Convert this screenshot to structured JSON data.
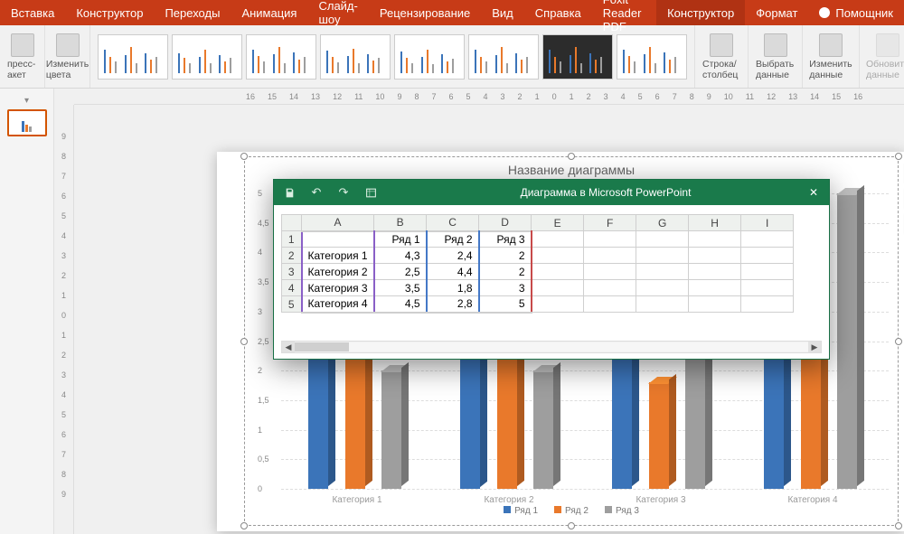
{
  "ribbonTabs": [
    {
      "label": "Вставка"
    },
    {
      "label": "Конструктор"
    },
    {
      "label": "Переходы"
    },
    {
      "label": "Анимация"
    },
    {
      "label": "Слайд-шоу"
    },
    {
      "label": "Рецензирование"
    },
    {
      "label": "Вид"
    },
    {
      "label": "Справка"
    },
    {
      "label": "Foxit Reader PDF"
    },
    {
      "label": "Конструктор",
      "active": true
    },
    {
      "label": "Формат"
    },
    {
      "label": "Помощник",
      "help": true
    }
  ],
  "ribbonGroups": {
    "express": "пресс-\nакет",
    "changeColors": "Изменить\nцвета",
    "rowCol": "Строка/\nстолбец",
    "selectData": "Выбрать\nданные",
    "editData": "Изменить\nданные",
    "refreshData": "Обновить\nданные"
  },
  "dataWindow": {
    "title": "Диаграмма в Microsoft PowerPoint",
    "columns": [
      "A",
      "B",
      "C",
      "D",
      "E",
      "F",
      "G",
      "H",
      "I"
    ],
    "headers": [
      "",
      "Ряд 1",
      "Ряд 2",
      "Ряд 3"
    ],
    "rows": [
      {
        "n": "2",
        "cat": "Категория 1",
        "v": [
          "4,3",
          "2,4",
          "2"
        ]
      },
      {
        "n": "3",
        "cat": "Категория 2",
        "v": [
          "2,5",
          "4,4",
          "2"
        ]
      },
      {
        "n": "4",
        "cat": "Категория 3",
        "v": [
          "3,5",
          "1,8",
          "3"
        ]
      },
      {
        "n": "5",
        "cat": "Категория 4",
        "v": [
          "4,5",
          "2,8",
          "5"
        ]
      }
    ]
  },
  "chart": {
    "title": "Название диаграммы",
    "yticks": [
      "0",
      "0,5",
      "1",
      "1,5",
      "2",
      "2,5",
      "3",
      "3,5",
      "4",
      "4,5",
      "5"
    ],
    "legend": [
      "Ряд 1",
      "Ряд 2",
      "Ряд 3"
    ]
  },
  "rulerH": [
    "16",
    "15",
    "14",
    "13",
    "12",
    "11",
    "10",
    "9",
    "8",
    "7",
    "6",
    "5",
    "4",
    "3",
    "2",
    "1",
    "0",
    "1",
    "2",
    "3",
    "4",
    "5",
    "6",
    "7",
    "8",
    "9",
    "10",
    "11",
    "12",
    "13",
    "14",
    "15",
    "16"
  ],
  "rulerV": [
    "9",
    "8",
    "7",
    "6",
    "5",
    "4",
    "3",
    "2",
    "1",
    "0",
    "1",
    "2",
    "3",
    "4",
    "5",
    "6",
    "7",
    "8",
    "9"
  ],
  "chart_data": {
    "type": "bar",
    "title": "Название диаграммы",
    "categories": [
      "Категория 1",
      "Категория 2",
      "Категория 3",
      "Категория 4"
    ],
    "series": [
      {
        "name": "Ряд 1",
        "values": [
          4.3,
          2.5,
          3.5,
          4.5
        ],
        "color": "#3b74b9"
      },
      {
        "name": "Ряд 2",
        "values": [
          2.4,
          4.4,
          1.8,
          2.8
        ],
        "color": "#e9792b"
      },
      {
        "name": "Ряд 3",
        "values": [
          2,
          2,
          3,
          5
        ],
        "color": "#9e9e9e"
      }
    ],
    "ylim": [
      0,
      5
    ],
    "ylabel": "",
    "xlabel": ""
  }
}
